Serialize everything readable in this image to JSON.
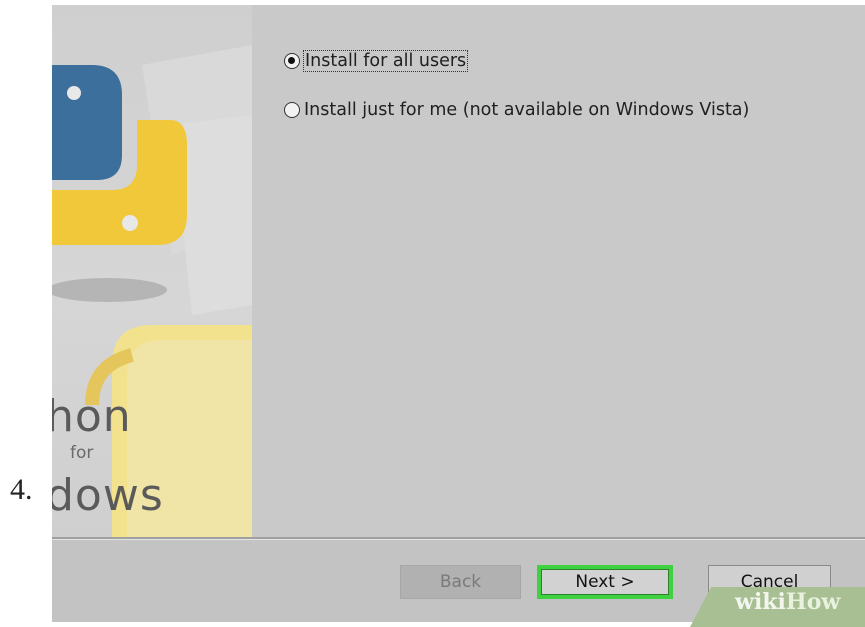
{
  "step": {
    "number": "4."
  },
  "options": {
    "all_users": {
      "label": "Install for all users",
      "checked": true
    },
    "just_me": {
      "label": "Install just for me (not available on Windows Vista)",
      "checked": false
    }
  },
  "banner": {
    "line1": "hon",
    "line2": "for",
    "line3": "dows"
  },
  "buttons": {
    "back": "Back",
    "next": "Next >",
    "cancel": "Cancel"
  },
  "watermark": {
    "part1": "wiki",
    "part2": "How"
  },
  "colors": {
    "highlight": "#3fd13f",
    "python_blue": "#3c6f9c",
    "python_yellow": "#f0c83a"
  }
}
